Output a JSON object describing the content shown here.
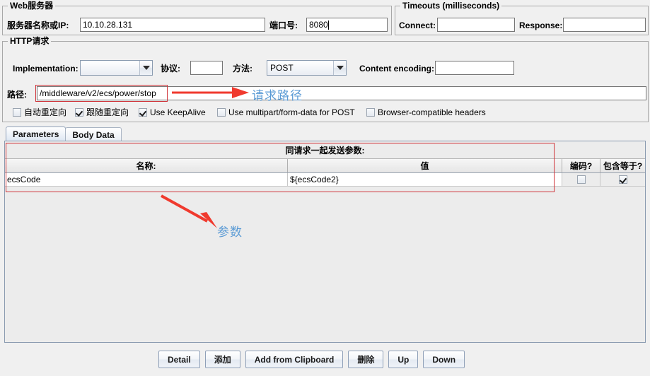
{
  "webserver": {
    "group_title": "Web服务器",
    "server_label": "服务器名称或IP:",
    "server_value": "10.10.28.131",
    "port_label": "端口号:",
    "port_value": "8080"
  },
  "timeouts": {
    "group_title": "Timeouts (milliseconds)",
    "connect_label": "Connect:",
    "connect_value": "",
    "response_label": "Response:",
    "response_value": ""
  },
  "http_request": {
    "group_title": "HTTP请求",
    "implementation_label": "Implementation:",
    "implementation_value": "",
    "protocol_label": "协议:",
    "protocol_value": "",
    "method_label": "方法:",
    "method_value": "POST",
    "content_encoding_label": "Content encoding:",
    "content_encoding_value": "",
    "path_label": "路径:",
    "path_value": "/middleware/v2/ecs/power/stop",
    "checkboxes": [
      {
        "label": "自动重定向",
        "checked": false
      },
      {
        "label": "跟随重定向",
        "checked": true
      },
      {
        "label": "Use KeepAlive",
        "checked": true
      },
      {
        "label": "Use multipart/form-data for POST",
        "checked": false
      },
      {
        "label": "Browser-compatible headers",
        "checked": false
      }
    ]
  },
  "tabs": [
    {
      "label": "Parameters",
      "selected": true
    },
    {
      "label": "Body Data",
      "selected": false
    }
  ],
  "params_table": {
    "title": "同请求一起发送参数:",
    "columns": [
      "名称:",
      "值",
      "编码?",
      "包含等于?"
    ],
    "rows": [
      {
        "name": "ecsCode",
        "value": "${ecsCode2}",
        "encode": false,
        "include_equals": true
      }
    ]
  },
  "buttons": [
    {
      "label": "Detail"
    },
    {
      "label": "添加"
    },
    {
      "label": "Add from Clipboard"
    },
    {
      "label": "删除"
    },
    {
      "label": "Up"
    },
    {
      "label": "Down"
    }
  ],
  "annotations": {
    "path_note": "请求路径",
    "params_note": "参数",
    "arrow_color": "#f03a2e",
    "note_color": "#5b9bd5",
    "highlight_color": "#d0343a"
  }
}
